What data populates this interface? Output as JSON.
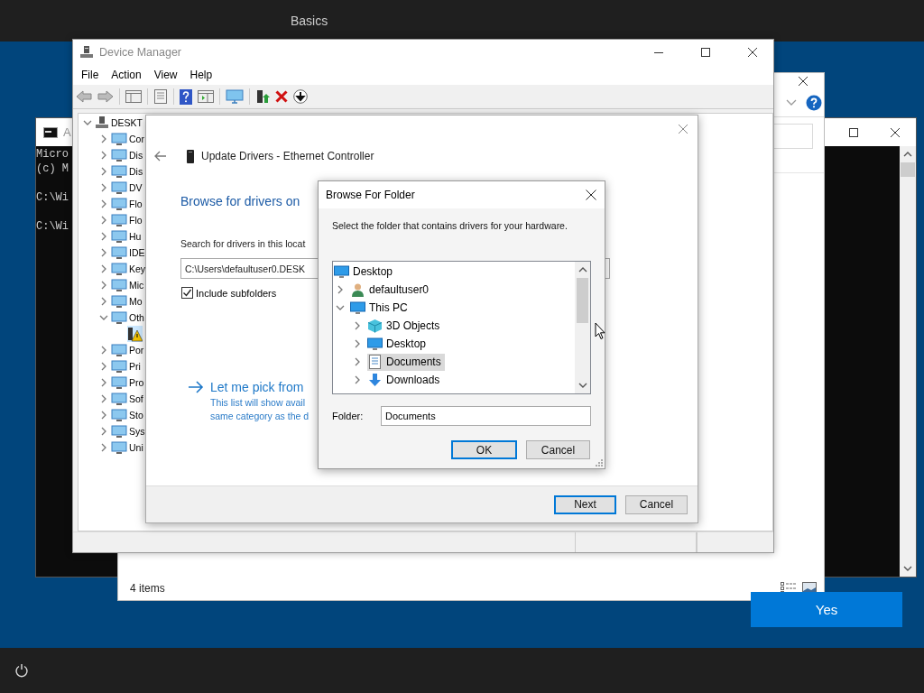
{
  "top_bar": {
    "title": "Basics"
  },
  "cmd_window": {
    "title": "A",
    "paragraphs": [
      [
        "Micro",
        "(c) M"
      ],
      [
        "C:\\Wi"
      ],
      [
        "C:\\Wi"
      ]
    ]
  },
  "explorer_window": {
    "status": "4 items"
  },
  "yes_button": "Yes",
  "device_manager": {
    "title": "Device Manager",
    "menu": [
      "File",
      "Action",
      "View",
      "Help"
    ],
    "tree": {
      "label": "DESKT",
      "expanded": true,
      "selected": false,
      "children": [
        {
          "label": "Cor",
          "expanded": false,
          "selected": false
        },
        {
          "label": "Dis",
          "expanded": false,
          "selected": false
        },
        {
          "label": "Dis",
          "expanded": false,
          "selected": false
        },
        {
          "label": "DV",
          "expanded": false,
          "selected": false
        },
        {
          "label": "Flo",
          "expanded": false,
          "selected": false
        },
        {
          "label": "Flo",
          "expanded": false,
          "selected": false
        },
        {
          "label": "Hu",
          "expanded": false,
          "selected": false
        },
        {
          "label": "IDE",
          "expanded": false,
          "selected": false
        },
        {
          "label": "Key",
          "expanded": false,
          "selected": false
        },
        {
          "label": "Mic",
          "expanded": false,
          "selected": false
        },
        {
          "label": "Mo",
          "expanded": false,
          "selected": false
        },
        {
          "label": "Oth",
          "expanded": true,
          "selected": false,
          "children": [
            {
              "selected": true
            }
          ]
        },
        {
          "label": "Por",
          "expanded": false,
          "selected": false
        },
        {
          "label": "Pri",
          "expanded": false,
          "selected": false
        },
        {
          "label": "Pro",
          "expanded": false,
          "selected": false
        },
        {
          "label": "Sof",
          "expanded": false,
          "selected": false
        },
        {
          "label": "Sto",
          "expanded": false,
          "selected": false
        },
        {
          "label": "Sys",
          "expanded": false,
          "selected": false
        },
        {
          "label": "Uni",
          "expanded": false,
          "selected": false
        }
      ]
    }
  },
  "update_drivers": {
    "title": "Update Drivers - Ethernet Controller",
    "heading": "Browse for drivers on",
    "search_label": "Search for drivers in this locat",
    "path": "C:\\Users\\defaultuser0.DESK",
    "include_subfolders": {
      "label": "Include subfolders",
      "checked": true
    },
    "pick_link": {
      "title": "Let me pick from",
      "description": [
        "This list will show avail",
        "same category as the d"
      ]
    },
    "buttons": [
      {
        "label": "Next",
        "default": true
      },
      {
        "label": "Cancel",
        "default": false
      }
    ]
  },
  "browse_folder": {
    "title": "Browse For Folder",
    "prompt": "Select the folder that contains drivers for your hardware.",
    "tree": {
      "label": "Desktop",
      "selected": false,
      "children": [
        {
          "label": "defaultuser0",
          "expanded": false,
          "selected": false
        },
        {
          "label": "This PC",
          "expanded": true,
          "selected": false,
          "children": [
            {
              "label": "3D Objects",
              "expanded": false,
              "selected": false
            },
            {
              "label": "Desktop",
              "expanded": false,
              "selected": false
            },
            {
              "label": "Documents",
              "expanded": false,
              "selected": true
            },
            {
              "label": "Downloads",
              "expanded": false,
              "selected": false
            }
          ]
        }
      ]
    },
    "folder_label": "Folder:",
    "folder_value": "Documents",
    "buttons": [
      {
        "label": "OK",
        "default": true
      },
      {
        "label": "Cancel",
        "default": false
      }
    ]
  }
}
